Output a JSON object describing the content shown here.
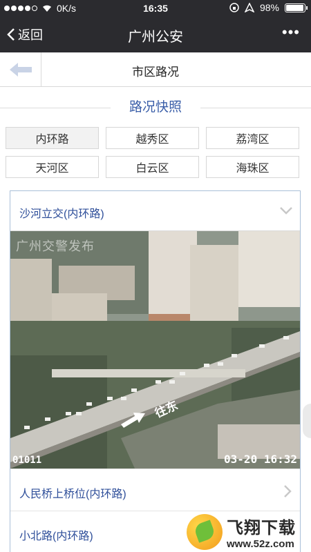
{
  "status_bar": {
    "carrier": "0K/s",
    "time": "16:35",
    "battery": "98%",
    "battery_level": 0.98
  },
  "nav": {
    "back_label": "返回",
    "title": "广州公安",
    "more": "•••"
  },
  "subheader": {
    "title": "市区路况"
  },
  "section": {
    "title": "路况快照"
  },
  "districts": [
    "内环路",
    "越秀区",
    "荔湾区",
    "天河区",
    "白云区",
    "海珠区"
  ],
  "selected_district": "内环路",
  "cameras": [
    {
      "label": "沙河立交(内环路)"
    },
    {
      "label": "人民桥上桥位(内环路)"
    },
    {
      "label": "小北路(内环路)"
    }
  ],
  "camera_image": {
    "watermark": "广州交警发布",
    "camera_id": "01011",
    "timestamp": "03-20 16:32",
    "direction": "往东"
  },
  "logo": {
    "name": "飞翔下载",
    "url": "www.52z.com"
  }
}
